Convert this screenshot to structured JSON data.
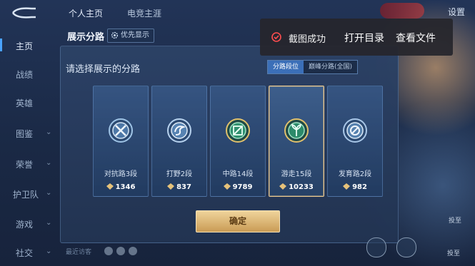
{
  "nav": {
    "tabs": [
      {
        "label": "个人主页",
        "active": true
      },
      {
        "label": "电竞主涯",
        "active": false
      }
    ],
    "settings_label": "设置"
  },
  "sidebar": {
    "items": [
      {
        "label": "主页",
        "active": true,
        "chevron": false
      },
      {
        "label": "战绩",
        "active": false,
        "chevron": false
      },
      {
        "label": "英雄",
        "active": false,
        "chevron": false
      },
      {
        "label": "图鉴",
        "active": false,
        "chevron": true
      },
      {
        "label": "荣誉",
        "active": false,
        "chevron": true
      },
      {
        "label": "护卫队",
        "active": false,
        "chevron": true
      },
      {
        "label": "游戏",
        "active": false,
        "chevron": true
      },
      {
        "label": "社交",
        "active": false,
        "chevron": true
      }
    ]
  },
  "panel": {
    "title": "展示分路",
    "priority_button": "优先显示",
    "prompt": "请选择展示的分路",
    "segments": [
      {
        "label": "分路段位",
        "active": true
      },
      {
        "label": "巅峰分路(全国)",
        "active": false
      }
    ],
    "cards": [
      {
        "name": "对抗路3段",
        "score": "1346",
        "selected": false,
        "badge": "silver-sword",
        "accent": "#9fc4e6"
      },
      {
        "name": "打野2段",
        "score": "837",
        "selected": false,
        "badge": "silver-swirl",
        "accent": "#b7d2ee"
      },
      {
        "name": "中路14段",
        "score": "9789",
        "selected": false,
        "badge": "green-lane",
        "accent": "#5fc79a"
      },
      {
        "name": "游走15段",
        "score": "10233",
        "selected": true,
        "badge": "green-leaf",
        "accent": "#4fbf8f"
      },
      {
        "name": "发育路2段",
        "score": "982",
        "selected": false,
        "badge": "silver-shield",
        "accent": "#a9c7e8"
      }
    ],
    "confirm_label": "确定"
  },
  "toast": {
    "message": "截图成功",
    "actions": [
      "打开目录",
      "查看文件"
    ]
  },
  "bottom": {
    "hint": "最近访客"
  },
  "right_tools": [
    {
      "label": "投至"
    },
    {
      "label": "投至"
    }
  ],
  "colors": {
    "accent_blue": "#3b6fb8",
    "gold": "#e9c78e",
    "toast_bg": "#26262c"
  }
}
